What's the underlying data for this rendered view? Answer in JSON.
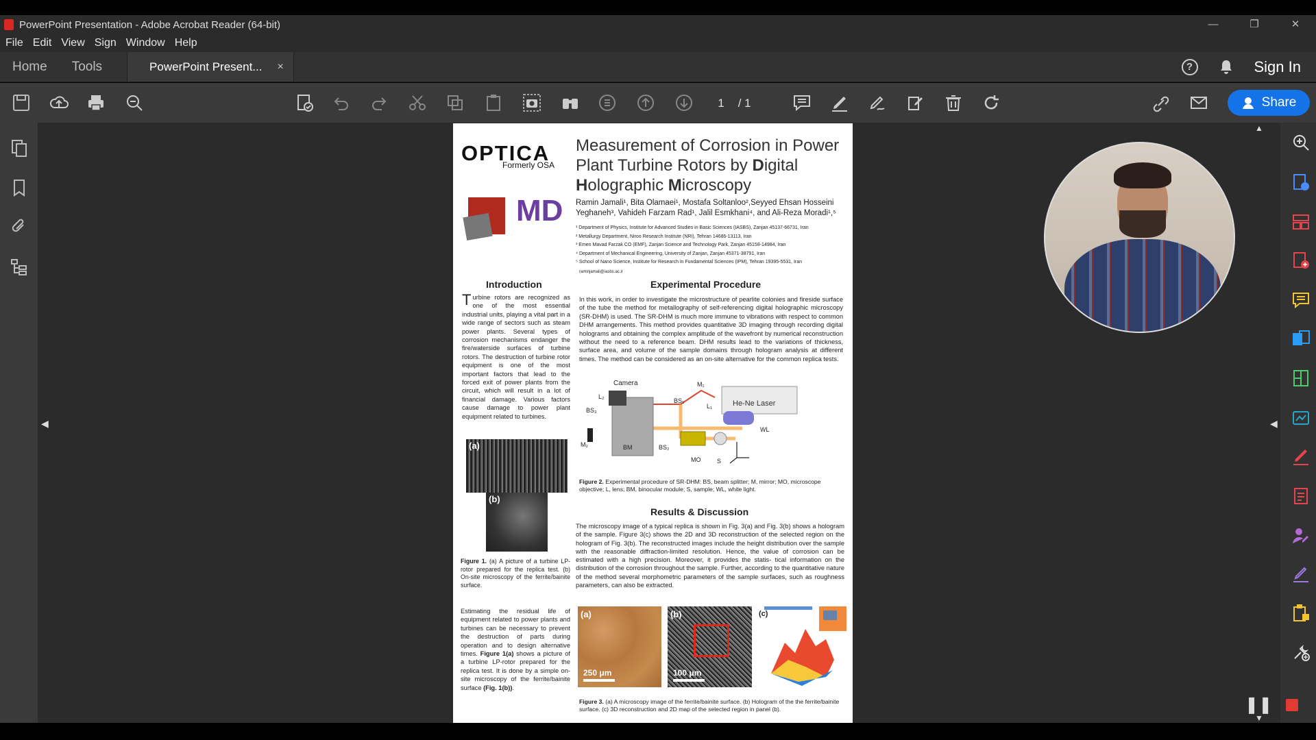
{
  "window": {
    "title": "PowerPoint Presentation - Adobe Acrobat Reader (64-bit)",
    "controls": {
      "minimize": "—",
      "restore": "❐",
      "close": "✕"
    }
  },
  "menu": [
    "File",
    "Edit",
    "View",
    "Sign",
    "Window",
    "Help"
  ],
  "tabs": {
    "home": "Home",
    "tools": "Tools",
    "document": "PowerPoint Present...",
    "close_glyph": "×"
  },
  "header": {
    "help_glyph": "?",
    "sign_in": "Sign In"
  },
  "toolbar": {
    "current_page": "1",
    "total_pages": "/ 1",
    "share_label": "Share"
  },
  "poster": {
    "optica": "OPTICA",
    "formerly": "Formerly OSA",
    "md_logo": "MD",
    "title_parts": [
      "Measurement of Corrosion in Power Plant Turbine Rotors by ",
      "D",
      "igital ",
      "H",
      "olographic ",
      "M",
      "icroscopy"
    ],
    "authors": "Ramin Jamali¹, Bita Olamaei¹, Mostafa Soltanloo²,Seyyed Ehsan Hosseini Yeghaneh³, Vahideh Farzam Rad¹, Jalil Esmkhani⁴, and Ali-Reza Moradi¹,⁵",
    "affiliations": [
      "¹ Department of Physics, Institute for Advanced Studies in Basic Sciences (IASBS), Zanjan 45137-66731, Iran",
      "² Metallurgy Department, Niroo Research Institute (NRI), Tehran 14686-13113, Iran",
      "³ Emen Mavad Farzak CO (EMF), Zanjan Science and Technology Park, Zanjan 45158-14984, Iran",
      "⁴ Department of Mechanical Engineering, University of Zanjan, Zanjan 45371-38791, Iran",
      "⁵ School of Nano Science, Institute for Research in Fundamental Sciences (IPM), Tehran 19395-5531, Iran"
    ],
    "email": "raminjamali@iasbs.ac.ir",
    "intro_heading": "Introduction",
    "intro_dropcap": "T",
    "intro_text": "urbine rotors are recognized as one of the most essential industrial units, playing a vital part in a wide range of sectors such as steam power plants. Several types of corrosion mechanisms endanger the fire/waterside surfaces of turbine rotors. The destruction of turbine rotor equipment is one of the most important factors that lead to the forced exit of power plants from the circuit, which will result in a lot of financial damage. Various factors cause damage to power plant equipment related to turbines.",
    "exp_heading": "Experimental Procedure",
    "exp_text": "In this work, in order to investigate the microstructure of pearlite colonies and fireside surface of the tube the method for metallography of self-referencing digital holographic microscopy (SR-DHM) is used. The SR-DHM is much more immune to vibrations with respect to common DHM arrangements. This method provides quantitative 3D imaging through recording digital holograms and obtaining the complex amplitude of the wavefront by numerical reconstruction without the need to a reference beam. DHM results lead to the variations of thickness, surface area, and volume of the sample domains through hologram analysis at different times. The method can be considered as an on-site alternative for the common replica tests.",
    "diagram_labels": {
      "camera": "Camera",
      "l2": "L₂",
      "bs3": "BS₃",
      "m1": "M₁",
      "bs1": "BS₁",
      "l1": "L₁",
      "laser": "He-Ne Laser",
      "wl": "WL",
      "m2": "M₂",
      "bm": "BM",
      "bs2": "BS₂",
      "mo": "MO",
      "s": "S"
    },
    "fig2_label": "Figure 2.",
    "fig2_caption": " Experimental procedure of SR-DHM: BS, beam splitter; M, mirror; MO, microscope objective; L, lens; BM, binocular module; S, sample; WL, white light.",
    "results_heading": "Results & Discussion",
    "results_text": "The microscopy image of a typical replica is shown in Fig. 3(a) and Fig. 3(b) shows a hologram of the sample. Figure 3(c) shows the 2D and 3D reconstruction of the selected region on the hologram of Fig. 3(b). The reconstructed images include the height distribution over the sample with the reasonable diffraction-limited resolution. Hence, the value of corrosion can be estimated with a high precision. Moreover, it provides the statis- tical information on the distribution of the corrosion throughout the sample. Further, according to the quantitative nature of the method several morphometric parameters of the sample surfaces, such as roughness parameters, can also be extracted.",
    "fig1_panel_a": "(a)",
    "fig1_panel_b": "(b)",
    "fig1_label": "Figure 1.",
    "fig1_caption": " (a) A picture of a turbine LP-rotor prepared for the replica test. (b) On-site microscopy of the ferrite/bainite surface.",
    "estimate_text": "Estimating the residual life of equipment related to power plants and turbines can be necessary to prevent the destruction of parts during operation and to design alternative times.",
    "estimate_fig_ref": "Figure 1(a)",
    "estimate_text2": " shows a picture of a turbine LP-rotor prepared for the replica test. It is done by a simple on-site microscopy of the ferrite/bainite surface ",
    "estimate_fig_ref2": "(Fig. 1(b))",
    "estimate_end": ".",
    "fig3_panel_a": "(a)",
    "fig3_panel_b": "(b)",
    "fig3_panel_c": "(c)",
    "fig3a_scale": "250 μm",
    "fig3b_scale": "100 μm",
    "fig3_label": "Figure 3.",
    "fig3_caption": " (a) A microscopy image of the ferrite/bainite surface. (b) Hologram of the the ferrite/bainite surface. (c) 3D reconstruction and 2D map of the selected region in panel (b)."
  },
  "colors": {
    "accent_blue": "#1473e6",
    "record_red": "#e23b33",
    "right_rail_icons": [
      "#4a8cff",
      "#1fa0ff",
      "#e4444c",
      "#f4c431",
      "#2b9bf4",
      "#4ecb71",
      "#26a6c9",
      "#e4444c",
      "#e4444c",
      "#b06bd6",
      "#9c79e0",
      "#f4c431",
      "#dddddd"
    ]
  }
}
